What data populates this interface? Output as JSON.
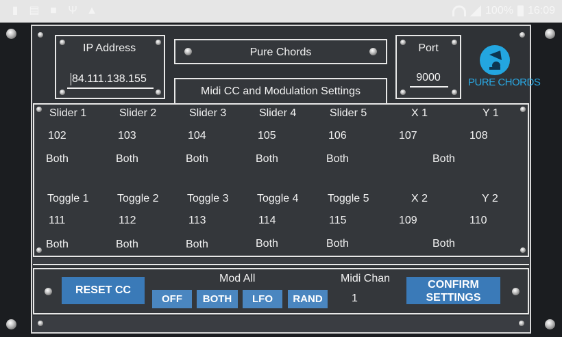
{
  "status_bar": {
    "left_icons": [
      "pin-icon",
      "trash-icon",
      "facebook-icon",
      "usb-icon",
      "android-icon"
    ],
    "battery": "100%",
    "time": "16:09"
  },
  "header": {
    "ip_label": "IP Address",
    "ip_value": "84.111.138.155",
    "app_title": "Pure Chords",
    "settings_title": "Midi CC and Modulation Settings",
    "port_label": "Port",
    "port_value": "9000",
    "logo_text": "PURE CHORDS"
  },
  "sliders": [
    {
      "label": "Slider 1",
      "cc": "102",
      "mode": "Both"
    },
    {
      "label": "Slider 2",
      "cc": "103",
      "mode": "Both"
    },
    {
      "label": "Slider 3",
      "cc": "104",
      "mode": "Both"
    },
    {
      "label": "Slider 4",
      "cc": "105",
      "mode": "Both"
    },
    {
      "label": "Slider 5",
      "cc": "106",
      "mode": "Both"
    },
    {
      "label": "X 1",
      "cc": "107"
    },
    {
      "label": "Y 1",
      "cc": "108"
    }
  ],
  "xy1_mode": "Both",
  "toggles": [
    {
      "label": "Toggle 1",
      "cc": "111",
      "mode": "Both"
    },
    {
      "label": "Toggle 2",
      "cc": "112",
      "mode": "Both"
    },
    {
      "label": "Toggle 3",
      "cc": "113",
      "mode": "Both"
    },
    {
      "label": "Toggle 4",
      "cc": "114",
      "mode": "Both"
    },
    {
      "label": "Toggle 5",
      "cc": "115",
      "mode": "Both"
    },
    {
      "label": "X 2",
      "cc": "109"
    },
    {
      "label": "Y 2",
      "cc": "110"
    }
  ],
  "xy2_mode": "Both",
  "bottom": {
    "reset_label": "RESET CC",
    "mod_all_label": "Mod All",
    "mod_buttons": [
      "OFF",
      "BOTH",
      "LFO",
      "RAND"
    ],
    "midi_chan_label": "Midi Chan",
    "midi_chan_value": "1",
    "confirm_line1": "CONFIRM",
    "confirm_line2": "SETTINGS"
  },
  "colors": {
    "button_blue": "#3a7ab8",
    "panel": "#34373b",
    "logo_blue": "#23a6e0"
  }
}
